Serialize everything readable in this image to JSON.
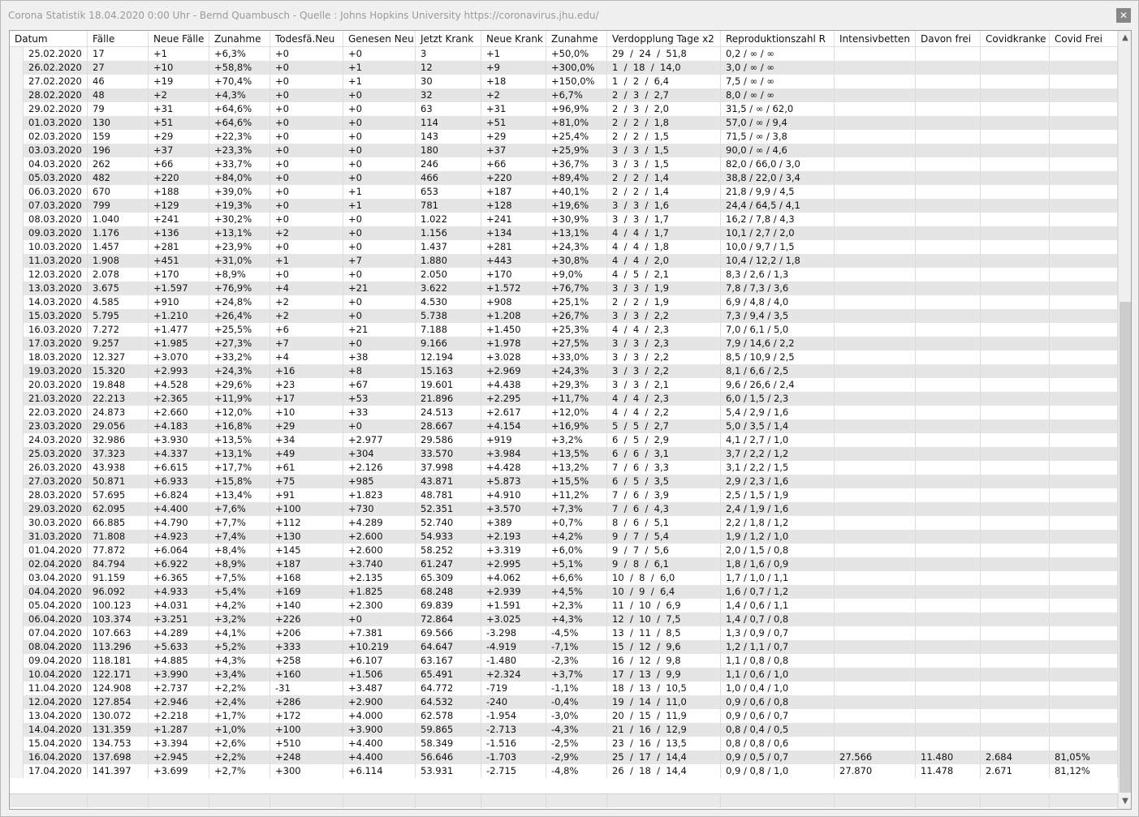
{
  "window": {
    "title": "Corona Statistik 18.04.2020 0:00 Uhr - Bernd Quambusch - Quelle : Johns Hopkins University https://coronavirus.jhu.edu/",
    "close_glyph": "✕"
  },
  "scroll": {
    "up_glyph": "▲",
    "down_glyph": "▼",
    "position": 0.35
  },
  "table": {
    "columns": [
      "Datum",
      "Fälle",
      "Neue Fälle",
      "Zunahme",
      "Todesfä.Neu",
      "Genesen Neu",
      "Jetzt Krank",
      "Neue Krank",
      "Zunahme",
      "Verdopplung Tage x2",
      "Reproduktionszahl R",
      "Intensivbetten",
      "Davon frei",
      "Covidkranke",
      "Covid Frei"
    ],
    "rows": [
      [
        "25.02.2020",
        "17",
        "+1",
        "+6,3%",
        "+0",
        "+0",
        "3",
        "+1",
        "+50,0%",
        "29  /  24  /  51,8",
        "0,2 / ∞ / ∞",
        "",
        "",
        "",
        ""
      ],
      [
        "26.02.2020",
        "27",
        "+10",
        "+58,8%",
        "+0",
        "+1",
        "12",
        "+9",
        "+300,0%",
        "1  /  18  /  14,0",
        "3,0 / ∞ / ∞",
        "",
        "",
        "",
        ""
      ],
      [
        "27.02.2020",
        "46",
        "+19",
        "+70,4%",
        "+0",
        "+1",
        "30",
        "+18",
        "+150,0%",
        "1  /  2  /  6,4",
        "7,5 / ∞ / ∞",
        "",
        "",
        "",
        ""
      ],
      [
        "28.02.2020",
        "48",
        "+2",
        "+4,3%",
        "+0",
        "+0",
        "32",
        "+2",
        "+6,7%",
        "2  /  3  /  2,7",
        "8,0 / ∞ / ∞",
        "",
        "",
        "",
        ""
      ],
      [
        "29.02.2020",
        "79",
        "+31",
        "+64,6%",
        "+0",
        "+0",
        "63",
        "+31",
        "+96,9%",
        "2  /  3  /  2,0",
        "31,5 / ∞ / 62,0",
        "",
        "",
        "",
        ""
      ],
      [
        "01.03.2020",
        "130",
        "+51",
        "+64,6%",
        "+0",
        "+0",
        "114",
        "+51",
        "+81,0%",
        "2  /  2  /  1,8",
        "57,0 / ∞ / 9,4",
        "",
        "",
        "",
        ""
      ],
      [
        "02.03.2020",
        "159",
        "+29",
        "+22,3%",
        "+0",
        "+0",
        "143",
        "+29",
        "+25,4%",
        "2  /  2  /  1,5",
        "71,5 / ∞ / 3,8",
        "",
        "",
        "",
        ""
      ],
      [
        "03.03.2020",
        "196",
        "+37",
        "+23,3%",
        "+0",
        "+0",
        "180",
        "+37",
        "+25,9%",
        "3  /  3  /  1,5",
        "90,0 / ∞ / 4,6",
        "",
        "",
        "",
        ""
      ],
      [
        "04.03.2020",
        "262",
        "+66",
        "+33,7%",
        "+0",
        "+0",
        "246",
        "+66",
        "+36,7%",
        "3  /  3  /  1,5",
        "82,0 / 66,0 / 3,0",
        "",
        "",
        "",
        ""
      ],
      [
        "05.03.2020",
        "482",
        "+220",
        "+84,0%",
        "+0",
        "+0",
        "466",
        "+220",
        "+89,4%",
        "2  /  2  /  1,4",
        "38,8 / 22,0 / 3,4",
        "",
        "",
        "",
        ""
      ],
      [
        "06.03.2020",
        "670",
        "+188",
        "+39,0%",
        "+0",
        "+1",
        "653",
        "+187",
        "+40,1%",
        "2  /  2  /  1,4",
        "21,8 / 9,9 / 4,5",
        "",
        "",
        "",
        ""
      ],
      [
        "07.03.2020",
        "799",
        "+129",
        "+19,3%",
        "+0",
        "+1",
        "781",
        "+128",
        "+19,6%",
        "3  /  3  /  1,6",
        "24,4 / 64,5 / 4,1",
        "",
        "",
        "",
        ""
      ],
      [
        "08.03.2020",
        "1.040",
        "+241",
        "+30,2%",
        "+0",
        "+0",
        "1.022",
        "+241",
        "+30,9%",
        "3  /  3  /  1,7",
        "16,2 / 7,8 / 4,3",
        "",
        "",
        "",
        ""
      ],
      [
        "09.03.2020",
        "1.176",
        "+136",
        "+13,1%",
        "+2",
        "+0",
        "1.156",
        "+134",
        "+13,1%",
        "4  /  4  /  1,7",
        "10,1 / 2,7 / 2,0",
        "",
        "",
        "",
        ""
      ],
      [
        "10.03.2020",
        "1.457",
        "+281",
        "+23,9%",
        "+0",
        "+0",
        "1.437",
        "+281",
        "+24,3%",
        "4  /  4  /  1,8",
        "10,0 / 9,7 / 1,5",
        "",
        "",
        "",
        ""
      ],
      [
        "11.03.2020",
        "1.908",
        "+451",
        "+31,0%",
        "+1",
        "+7",
        "1.880",
        "+443",
        "+30,8%",
        "4  /  4  /  2,0",
        "10,4 / 12,2 / 1,8",
        "",
        "",
        "",
        ""
      ],
      [
        "12.03.2020",
        "2.078",
        "+170",
        "+8,9%",
        "+0",
        "+0",
        "2.050",
        "+170",
        "+9,0%",
        "4  /  5  /  2,1",
        "8,3 / 2,6 / 1,3",
        "",
        "",
        "",
        ""
      ],
      [
        "13.03.2020",
        "3.675",
        "+1.597",
        "+76,9%",
        "+4",
        "+21",
        "3.622",
        "+1.572",
        "+76,7%",
        "3  /  3  /  1,9",
        "7,8 / 7,3 / 3,6",
        "",
        "",
        "",
        ""
      ],
      [
        "14.03.2020",
        "4.585",
        "+910",
        "+24,8%",
        "+2",
        "+0",
        "4.530",
        "+908",
        "+25,1%",
        "2  /  2  /  1,9",
        "6,9 / 4,8 / 4,0",
        "",
        "",
        "",
        ""
      ],
      [
        "15.03.2020",
        "5.795",
        "+1.210",
        "+26,4%",
        "+2",
        "+0",
        "5.738",
        "+1.208",
        "+26,7%",
        "3  /  3  /  2,2",
        "7,3 / 9,4 / 3,5",
        "",
        "",
        "",
        ""
      ],
      [
        "16.03.2020",
        "7.272",
        "+1.477",
        "+25,5%",
        "+6",
        "+21",
        "7.188",
        "+1.450",
        "+25,3%",
        "4  /  4  /  2,3",
        "7,0 / 6,1 / 5,0",
        "",
        "",
        "",
        ""
      ],
      [
        "17.03.2020",
        "9.257",
        "+1.985",
        "+27,3%",
        "+7",
        "+0",
        "9.166",
        "+1.978",
        "+27,5%",
        "3  /  3  /  2,3",
        "7,9 / 14,6 / 2,2",
        "",
        "",
        "",
        ""
      ],
      [
        "18.03.2020",
        "12.327",
        "+3.070",
        "+33,2%",
        "+4",
        "+38",
        "12.194",
        "+3.028",
        "+33,0%",
        "3  /  3  /  2,2",
        "8,5 / 10,9 / 2,5",
        "",
        "",
        "",
        ""
      ],
      [
        "19.03.2020",
        "15.320",
        "+2.993",
        "+24,3%",
        "+16",
        "+8",
        "15.163",
        "+2.969",
        "+24,3%",
        "3  /  3  /  2,2",
        "8,1 / 6,6 / 2,5",
        "",
        "",
        "",
        ""
      ],
      [
        "20.03.2020",
        "19.848",
        "+4.528",
        "+29,6%",
        "+23",
        "+67",
        "19.601",
        "+4.438",
        "+29,3%",
        "3  /  3  /  2,1",
        "9,6 / 26,6 / 2,4",
        "",
        "",
        "",
        ""
      ],
      [
        "21.03.2020",
        "22.213",
        "+2.365",
        "+11,9%",
        "+17",
        "+53",
        "21.896",
        "+2.295",
        "+11,7%",
        "4  /  4  /  2,3",
        "6,0 / 1,5 / 2,3",
        "",
        "",
        "",
        ""
      ],
      [
        "22.03.2020",
        "24.873",
        "+2.660",
        "+12,0%",
        "+10",
        "+33",
        "24.513",
        "+2.617",
        "+12,0%",
        "4  /  4  /  2,2",
        "5,4 / 2,9 / 1,6",
        "",
        "",
        "",
        ""
      ],
      [
        "23.03.2020",
        "29.056",
        "+4.183",
        "+16,8%",
        "+29",
        "+0",
        "28.667",
        "+4.154",
        "+16,9%",
        "5  /  5  /  2,7",
        "5,0 / 3,5 / 1,4",
        "",
        "",
        "",
        ""
      ],
      [
        "24.03.2020",
        "32.986",
        "+3.930",
        "+13,5%",
        "+34",
        "+2.977",
        "29.586",
        "+919",
        "+3,2%",
        "6  /  5  /  2,9",
        "4,1 / 2,7 / 1,0",
        "",
        "",
        "",
        ""
      ],
      [
        "25.03.2020",
        "37.323",
        "+4.337",
        "+13,1%",
        "+49",
        "+304",
        "33.570",
        "+3.984",
        "+13,5%",
        "6  /  6  /  3,1",
        "3,7 / 2,2 / 1,2",
        "",
        "",
        "",
        ""
      ],
      [
        "26.03.2020",
        "43.938",
        "+6.615",
        "+17,7%",
        "+61",
        "+2.126",
        "37.998",
        "+4.428",
        "+13,2%",
        "7  /  6  /  3,3",
        "3,1 / 2,2 / 1,5",
        "",
        "",
        "",
        ""
      ],
      [
        "27.03.2020",
        "50.871",
        "+6.933",
        "+15,8%",
        "+75",
        "+985",
        "43.871",
        "+5.873",
        "+15,5%",
        "6  /  5  /  3,5",
        "2,9 / 2,3 / 1,6",
        "",
        "",
        "",
        ""
      ],
      [
        "28.03.2020",
        "57.695",
        "+6.824",
        "+13,4%",
        "+91",
        "+1.823",
        "48.781",
        "+4.910",
        "+11,2%",
        "7  /  6  /  3,9",
        "2,5 / 1,5 / 1,9",
        "",
        "",
        "",
        ""
      ],
      [
        "29.03.2020",
        "62.095",
        "+4.400",
        "+7,6%",
        "+100",
        "+730",
        "52.351",
        "+3.570",
        "+7,3%",
        "7  /  6  /  4,3",
        "2,4 / 1,9 / 1,6",
        "",
        "",
        "",
        ""
      ],
      [
        "30.03.2020",
        "66.885",
        "+4.790",
        "+7,7%",
        "+112",
        "+4.289",
        "52.740",
        "+389",
        "+0,7%",
        "8  /  6  /  5,1",
        "2,2 / 1,8 / 1,2",
        "",
        "",
        "",
        ""
      ],
      [
        "31.03.2020",
        "71.808",
        "+4.923",
        "+7,4%",
        "+130",
        "+2.600",
        "54.933",
        "+2.193",
        "+4,2%",
        "9  /  7  /  5,4",
        "1,9 / 1,2 / 1,0",
        "",
        "",
        "",
        ""
      ],
      [
        "01.04.2020",
        "77.872",
        "+6.064",
        "+8,4%",
        "+145",
        "+2.600",
        "58.252",
        "+3.319",
        "+6,0%",
        "9  /  7  /  5,6",
        "2,0 / 1,5 / 0,8",
        "",
        "",
        "",
        ""
      ],
      [
        "02.04.2020",
        "84.794",
        "+6.922",
        "+8,9%",
        "+187",
        "+3.740",
        "61.247",
        "+2.995",
        "+5,1%",
        "9  /  8  /  6,1",
        "1,8 / 1,6 / 0,9",
        "",
        "",
        "",
        ""
      ],
      [
        "03.04.2020",
        "91.159",
        "+6.365",
        "+7,5%",
        "+168",
        "+2.135",
        "65.309",
        "+4.062",
        "+6,6%",
        "10  /  8  /  6,0",
        "1,7 / 1,0 / 1,1",
        "",
        "",
        "",
        ""
      ],
      [
        "04.04.2020",
        "96.092",
        "+4.933",
        "+5,4%",
        "+169",
        "+1.825",
        "68.248",
        "+2.939",
        "+4,5%",
        "10  /  9  /  6,4",
        "1,6 / 0,7 / 1,2",
        "",
        "",
        "",
        ""
      ],
      [
        "05.04.2020",
        "100.123",
        "+4.031",
        "+4,2%",
        "+140",
        "+2.300",
        "69.839",
        "+1.591",
        "+2,3%",
        "11  /  10  /  6,9",
        "1,4 / 0,6 / 1,1",
        "",
        "",
        "",
        ""
      ],
      [
        "06.04.2020",
        "103.374",
        "+3.251",
        "+3,2%",
        "+226",
        "+0",
        "72.864",
        "+3.025",
        "+4,3%",
        "12  /  10  /  7,5",
        "1,4 / 0,7 / 0,8",
        "",
        "",
        "",
        ""
      ],
      [
        "07.04.2020",
        "107.663",
        "+4.289",
        "+4,1%",
        "+206",
        "+7.381",
        "69.566",
        "-3.298",
        "-4,5%",
        "13  /  11  /  8,5",
        "1,3 / 0,9 / 0,7",
        "",
        "",
        "",
        ""
      ],
      [
        "08.04.2020",
        "113.296",
        "+5.633",
        "+5,2%",
        "+333",
        "+10.219",
        "64.647",
        "-4.919",
        "-7,1%",
        "15  /  12  /  9,6",
        "1,2 / 1,1 / 0,7",
        "",
        "",
        "",
        ""
      ],
      [
        "09.04.2020",
        "118.181",
        "+4.885",
        "+4,3%",
        "+258",
        "+6.107",
        "63.167",
        "-1.480",
        "-2,3%",
        "16  /  12  /  9,8",
        "1,1 / 0,8 / 0,8",
        "",
        "",
        "",
        ""
      ],
      [
        "10.04.2020",
        "122.171",
        "+3.990",
        "+3,4%",
        "+160",
        "+1.506",
        "65.491",
        "+2.324",
        "+3,7%",
        "17  /  13  /  9,9",
        "1,1 / 0,6 / 1,0",
        "",
        "",
        "",
        ""
      ],
      [
        "11.04.2020",
        "124.908",
        "+2.737",
        "+2,2%",
        "-31",
        "+3.487",
        "64.772",
        "-719",
        "-1,1%",
        "18  /  13  /  10,5",
        "1,0 / 0,4 / 1,0",
        "",
        "",
        "",
        ""
      ],
      [
        "12.04.2020",
        "127.854",
        "+2.946",
        "+2,4%",
        "+286",
        "+2.900",
        "64.532",
        "-240",
        "-0,4%",
        "19  /  14  /  11,0",
        "0,9 / 0,6 / 0,8",
        "",
        "",
        "",
        ""
      ],
      [
        "13.04.2020",
        "130.072",
        "+2.218",
        "+1,7%",
        "+172",
        "+4.000",
        "62.578",
        "-1.954",
        "-3,0%",
        "20  /  15  /  11,9",
        "0,9 / 0,6 / 0,7",
        "",
        "",
        "",
        ""
      ],
      [
        "14.04.2020",
        "131.359",
        "+1.287",
        "+1,0%",
        "+100",
        "+3.900",
        "59.865",
        "-2.713",
        "-4,3%",
        "21  /  16  /  12,9",
        "0,8 / 0,4 / 0,5",
        "",
        "",
        "",
        ""
      ],
      [
        "15.04.2020",
        "134.753",
        "+3.394",
        "+2,6%",
        "+510",
        "+4.400",
        "58.349",
        "-1.516",
        "-2,5%",
        "23  /  16  /  13,5",
        "0,8 / 0,8 / 0,6",
        "",
        "",
        "",
        ""
      ],
      [
        "16.04.2020",
        "137.698",
        "+2.945",
        "+2,2%",
        "+248",
        "+4.400",
        "56.646",
        "-1.703",
        "-2,9%",
        "25  /  17  /  14,4",
        "0,9 / 0,5 / 0,7",
        "27.566",
        "11.480",
        "2.684",
        "81,05%"
      ],
      [
        "17.04.2020",
        "141.397",
        "+3.699",
        "+2,7%",
        "+300",
        "+6.114",
        "53.931",
        "-2.715",
        "-4,8%",
        "26  /  18  /  14,4",
        "0,9 / 0,8 / 1,0",
        "27.870",
        "11.478",
        "2.671",
        "81,12%"
      ]
    ]
  }
}
